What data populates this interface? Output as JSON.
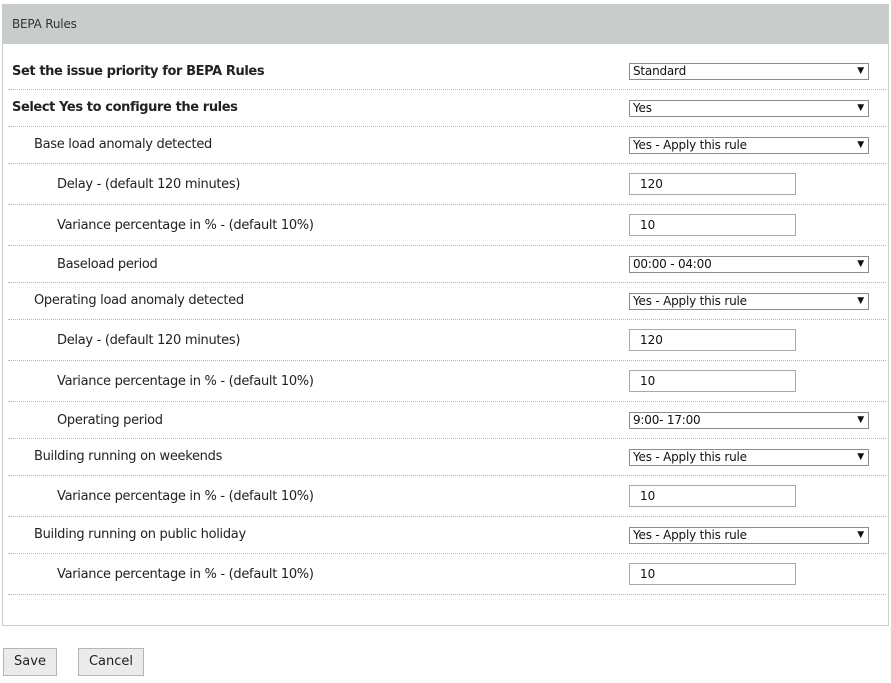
{
  "panel": {
    "title": "BEPA Rules"
  },
  "rows": [
    {
      "label": "Set the issue priority for BEPA Rules",
      "value": "Standard"
    },
    {
      "label": "Select Yes to configure the rules",
      "value": "Yes"
    },
    {
      "label": "Base load anomaly detected",
      "value": "Yes - Apply this rule"
    },
    {
      "label": "Delay - (default 120 minutes)",
      "value": "120"
    },
    {
      "label": "Variance percentage in % - (default 10%)",
      "value": "10"
    },
    {
      "label": "Baseload period",
      "value": "00:00 - 04:00"
    },
    {
      "label": "Operating load anomaly detected",
      "value": "Yes - Apply this rule"
    },
    {
      "label": "Delay - (default 120 minutes)",
      "value": "120"
    },
    {
      "label": "Variance percentage in % - (default 10%)",
      "value": "10"
    },
    {
      "label": "Operating period",
      "value": "9:00- 17:00"
    },
    {
      "label": "Building running on weekends",
      "value": "Yes - Apply this rule"
    },
    {
      "label": "Variance percentage in % - (default 10%)",
      "value": "10"
    },
    {
      "label": "Building running on public holiday",
      "value": "Yes - Apply this rule"
    },
    {
      "label": "Variance percentage in % - (default 10%)",
      "value": "10"
    }
  ],
  "icons": {
    "dropdown": "chevron-down-icon"
  },
  "buttons": {
    "save": "Save",
    "cancel": "Cancel"
  },
  "colors": {
    "header_bg": "#c8cccb",
    "button_bg": "#ebebeb"
  }
}
